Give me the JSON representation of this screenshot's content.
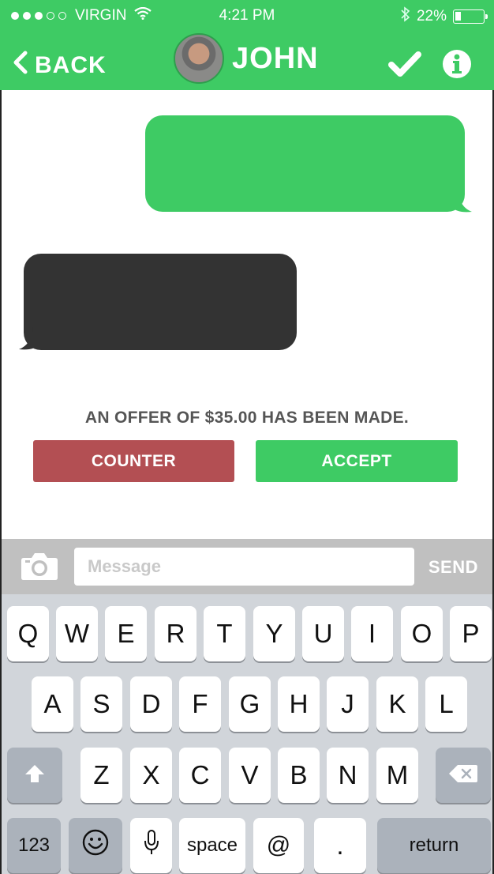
{
  "status_bar": {
    "signal_dots": 5,
    "signal_filled": 3,
    "carrier": "VIRGIN",
    "time": "4:21 PM",
    "battery_text": "22%",
    "battery_level": 0.22
  },
  "nav": {
    "back_label": "BACK",
    "title": "JOHN",
    "icons": [
      "chevron-left-icon",
      "avatar",
      "checkmark-icon",
      "info-icon"
    ]
  },
  "offer": {
    "text": "AN OFFER OF $35.00 HAS BEEN MADE.",
    "counter_label": "COUNTER",
    "accept_label": "ACCEPT"
  },
  "composer": {
    "placeholder": "Message",
    "value": "",
    "send_label": "SEND"
  },
  "keyboard": {
    "row1": [
      "Q",
      "W",
      "E",
      "R",
      "T",
      "Y",
      "U",
      "I",
      "O",
      "P"
    ],
    "row2": [
      "A",
      "S",
      "D",
      "F",
      "G",
      "H",
      "J",
      "K",
      "L"
    ],
    "row3": [
      "Z",
      "X",
      "C",
      "V",
      "B",
      "N",
      "M"
    ],
    "numbers_label": "123",
    "space_label": "space",
    "at_label": "@",
    "period_label": ".",
    "return_label": "return"
  },
  "colors": {
    "accent_green": "#3ecb64",
    "counter_red": "#b34f53",
    "incoming_bubble": "#333333",
    "keyboard_bg": "#d1d5da"
  }
}
